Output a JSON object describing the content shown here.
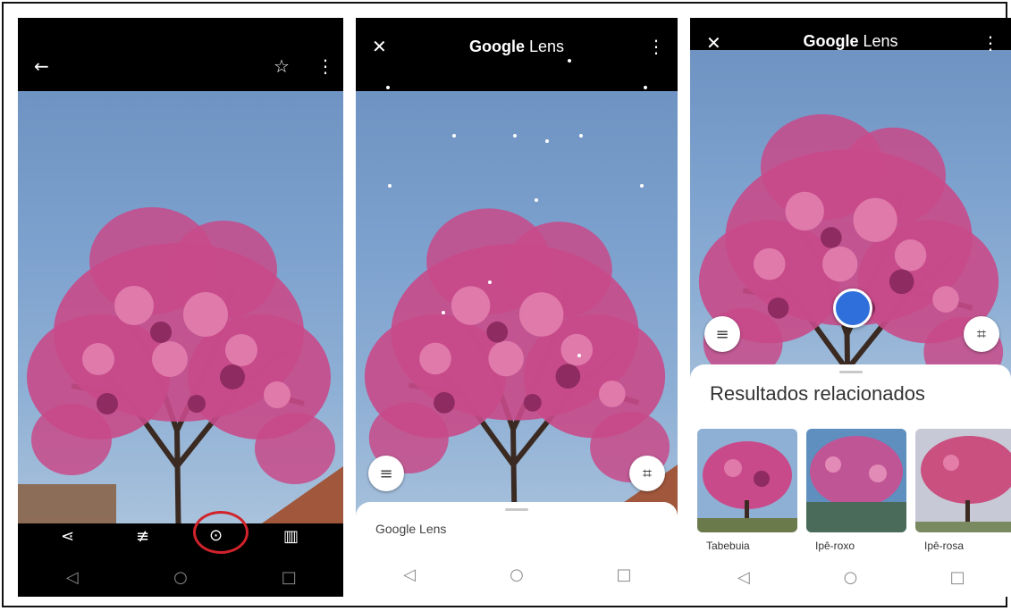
{
  "screen1": {
    "topbar": {
      "back_icon": "arrow-left-icon",
      "star_icon": "star-outline-icon",
      "menu_icon": "more-vert-icon"
    },
    "toolbar": [
      "share-icon",
      "tune-icon",
      "google-lens-icon",
      "delete-icon"
    ]
  },
  "screen2": {
    "title_bold": "Google",
    "title_rest": " Lens",
    "sheet_label": "Google Lens"
  },
  "screen3": {
    "title_bold": "Google",
    "title_rest": " Lens",
    "results_title": "Resultados relacionados",
    "results": [
      {
        "label": "Tabebuia"
      },
      {
        "label": "Ipê-roxo"
      },
      {
        "label": "Ipê-rosa"
      }
    ]
  },
  "colors": {
    "accent_blue": "#2f6fdc",
    "highlight_red": "#d0232a",
    "blossom": "#c84a8a"
  }
}
